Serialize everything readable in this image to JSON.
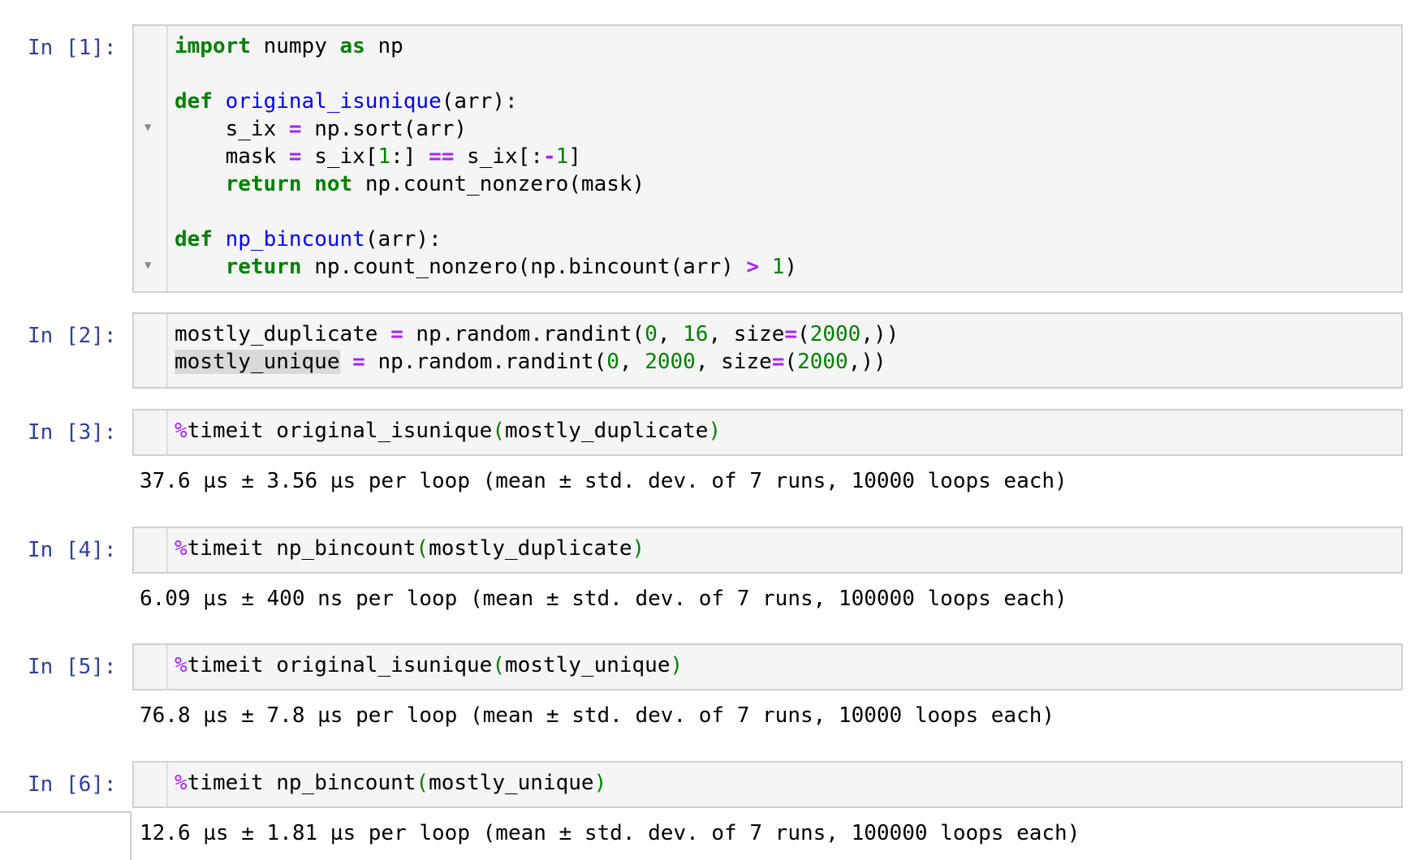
{
  "cells": [
    {
      "prompt": "In [1]:",
      "lines": [
        [
          {
            "t": "import",
            "c": "kw"
          },
          {
            "t": " numpy "
          },
          {
            "t": "as",
            "c": "kw"
          },
          {
            "t": " np"
          }
        ],
        [],
        [
          {
            "t": "def",
            "c": "kw"
          },
          {
            "t": " "
          },
          {
            "t": "original_isunique",
            "c": "fn"
          },
          {
            "t": "(arr):"
          }
        ],
        [
          {
            "t": "    s_ix "
          },
          {
            "t": "=",
            "c": "op"
          },
          {
            "t": " np.sort(arr)"
          }
        ],
        [
          {
            "t": "    mask "
          },
          {
            "t": "=",
            "c": "op"
          },
          {
            "t": " s_ix["
          },
          {
            "t": "1",
            "c": "num"
          },
          {
            "t": ":] "
          },
          {
            "t": "==",
            "c": "op"
          },
          {
            "t": " s_ix[:"
          },
          {
            "t": "-",
            "c": "op"
          },
          {
            "t": "1",
            "c": "num"
          },
          {
            "t": "]"
          }
        ],
        [
          {
            "t": "    "
          },
          {
            "t": "return",
            "c": "kw"
          },
          {
            "t": " "
          },
          {
            "t": "not",
            "c": "kw"
          },
          {
            "t": " np.count_nonzero(mask)"
          }
        ],
        [],
        [
          {
            "t": "def",
            "c": "kw"
          },
          {
            "t": " "
          },
          {
            "t": "np_bincount",
            "c": "fn"
          },
          {
            "t": "(arr):"
          }
        ],
        [
          {
            "t": "    "
          },
          {
            "t": "return",
            "c": "kw"
          },
          {
            "t": " np.count_nonzero(np.bincount(arr) "
          },
          {
            "t": ">",
            "c": "op"
          },
          {
            "t": " "
          },
          {
            "t": "1",
            "c": "num"
          },
          {
            "t": ")"
          }
        ]
      ],
      "output": ""
    },
    {
      "prompt": "In [2]:",
      "lines": [
        [
          {
            "t": "mostly_duplicate "
          },
          {
            "t": "=",
            "c": "op"
          },
          {
            "t": " np.random.randint("
          },
          {
            "t": "0",
            "c": "num"
          },
          {
            "t": ", "
          },
          {
            "t": "16",
            "c": "num"
          },
          {
            "t": ", size"
          },
          {
            "t": "=",
            "c": "op"
          },
          {
            "t": "("
          },
          {
            "t": "2000",
            "c": "num"
          },
          {
            "t": ",))"
          }
        ],
        [
          {
            "t": "mostly_unique",
            "c": "hl"
          },
          {
            "t": " "
          },
          {
            "t": "=",
            "c": "op"
          },
          {
            "t": " np.random.randint("
          },
          {
            "t": "0",
            "c": "num"
          },
          {
            "t": ", "
          },
          {
            "t": "2000",
            "c": "num"
          },
          {
            "t": ", size"
          },
          {
            "t": "=",
            "c": "op"
          },
          {
            "t": "("
          },
          {
            "t": "2000",
            "c": "num"
          },
          {
            "t": ",))"
          }
        ]
      ],
      "output": ""
    },
    {
      "prompt": "In [3]:",
      "lines": [
        [
          {
            "t": "%",
            "c": "magic"
          },
          {
            "t": "timeit original_isunique"
          },
          {
            "t": "(",
            "c": "paren"
          },
          {
            "t": "mostly_duplicate"
          },
          {
            "t": ")",
            "c": "paren"
          }
        ]
      ],
      "output": "37.6 µs ± 3.56 µs per loop (mean ± std. dev. of 7 runs, 10000 loops each)"
    },
    {
      "prompt": "In [4]:",
      "lines": [
        [
          {
            "t": "%",
            "c": "magic"
          },
          {
            "t": "timeit np_bincount"
          },
          {
            "t": "(",
            "c": "paren"
          },
          {
            "t": "mostly_duplicate"
          },
          {
            "t": ")",
            "c": "paren"
          }
        ]
      ],
      "output": "6.09 µs ± 400 ns per loop (mean ± std. dev. of 7 runs, 100000 loops each)"
    },
    {
      "prompt": "In [5]:",
      "lines": [
        [
          {
            "t": "%",
            "c": "magic"
          },
          {
            "t": "timeit original_isunique"
          },
          {
            "t": "(",
            "c": "paren"
          },
          {
            "t": "mostly_unique"
          },
          {
            "t": ")",
            "c": "paren"
          }
        ]
      ],
      "output": "76.8 µs ± 7.8 µs per loop (mean ± std. dev. of 7 runs, 10000 loops each)"
    },
    {
      "prompt": "In [6]:",
      "lines": [
        [
          {
            "t": "%",
            "c": "magic"
          },
          {
            "t": "timeit np_bincount"
          },
          {
            "t": "(",
            "c": "paren"
          },
          {
            "t": "mostly_unique"
          },
          {
            "t": ")",
            "c": "paren"
          }
        ]
      ],
      "output": "12.6 µs ± 1.81 µs per loop (mean ± std. dev. of 7 runs, 100000 loops each)"
    }
  ],
  "icons": {
    "fold": "▼"
  },
  "colors": {
    "prompt": "#303f9f",
    "keyword": "#008000",
    "function": "#0000ff",
    "operator": "#aa22ff",
    "number": "#008000",
    "cell_background": "#f5f5f5",
    "cell_border": "#cfcfcf"
  }
}
